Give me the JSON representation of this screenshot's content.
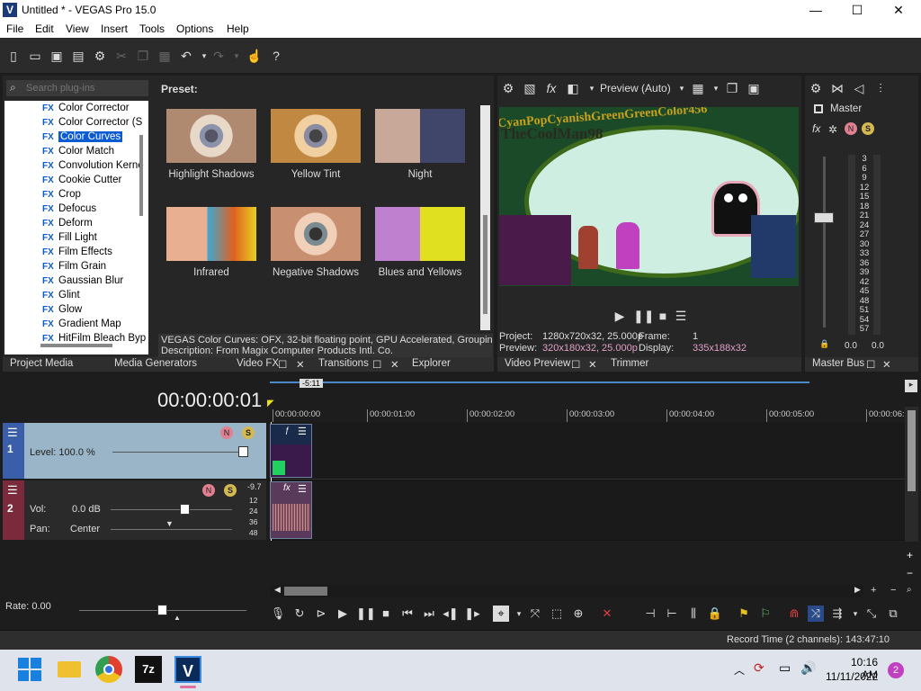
{
  "window": {
    "title": "Untitled * - VEGAS Pro 15.0",
    "app_icon": "V",
    "minimize": "—",
    "maximize": "☐",
    "close": "✕"
  },
  "menu": [
    "File",
    "Edit",
    "View",
    "Insert",
    "Tools",
    "Options",
    "Help"
  ],
  "plugins": {
    "search_placeholder": "Search plug-ins",
    "preset_label": "Preset:",
    "tree": [
      "Color Corrector",
      "Color Corrector (S",
      "Color Curves",
      "Color Match",
      "Convolution Kerne",
      "Cookie Cutter",
      "Crop",
      "Defocus",
      "Deform",
      "Fill Light",
      "Film Effects",
      "Film Grain",
      "Gaussian Blur",
      "Glint",
      "Glow",
      "Gradient Map",
      "HitFilm Bleach Byp"
    ],
    "selected": "Color Curves",
    "fx_tag": "FX",
    "presets": [
      "Highlight Shadows",
      "Yellow Tint",
      "Night",
      "Infrared",
      "Negative Shadows",
      "Blues and Yellows"
    ],
    "description_line1": "VEGAS Color Curves: OFX, 32-bit floating point, GPU Accelerated, Grouping V",
    "description_line2": "Description: From Magix Computer Products Intl. Co."
  },
  "left_tabs": [
    "Project Media",
    "Media Generators",
    "Video FX",
    "Transitions",
    "Explorer"
  ],
  "preview": {
    "mode": "Preview (Auto)",
    "project_label": "Project:",
    "project_value": "1280x720x32, 25.000p",
    "frame_label": "Frame:",
    "frame_value": "1",
    "preview_label": "Preview:",
    "preview_value": "320x180x32, 25.000p",
    "display_label": "Display:",
    "display_value": "335x188x32",
    "overlay_title": "TheCoolMan98",
    "overlay_subtitle": "CyanPopCyanishGreenGreenColor456"
  },
  "preview_tabs": [
    "Video Preview",
    "Trimmer"
  ],
  "master": {
    "label": "Master",
    "scale": [
      "3",
      "6",
      "9",
      "12",
      "15",
      "18",
      "21",
      "24",
      "27",
      "30",
      "33",
      "36",
      "39",
      "42",
      "45",
      "48",
      "51",
      "54",
      "57"
    ],
    "left_value": "0.0",
    "right_value": "0.0",
    "tab": "Master Bus"
  },
  "timeline": {
    "timecode": "00:00:00:01",
    "marker": "-5:11",
    "ruler": [
      "00:00:00:00",
      "00:00:01:00",
      "00:00:02:00",
      "00:00:03:00",
      "00:00:04:00",
      "00:00:05:00",
      "00:00:06:"
    ],
    "track1": {
      "number": "1",
      "level_label": "Level: 100.0 %"
    },
    "track2": {
      "number": "2",
      "vol_label": "Vol:",
      "vol_value": "0.0 dB",
      "pan_label": "Pan:",
      "pan_value": "Center",
      "peak": "-9.7",
      "meter": [
        "12",
        "24",
        "36",
        "48"
      ]
    },
    "rate": "Rate: 0.00"
  },
  "status": {
    "record_time": "Record Time (2 channels): 143:47:10"
  },
  "taskbar": {
    "time": "10:16 AM",
    "date": "11/11/2022",
    "notifications": "2"
  }
}
